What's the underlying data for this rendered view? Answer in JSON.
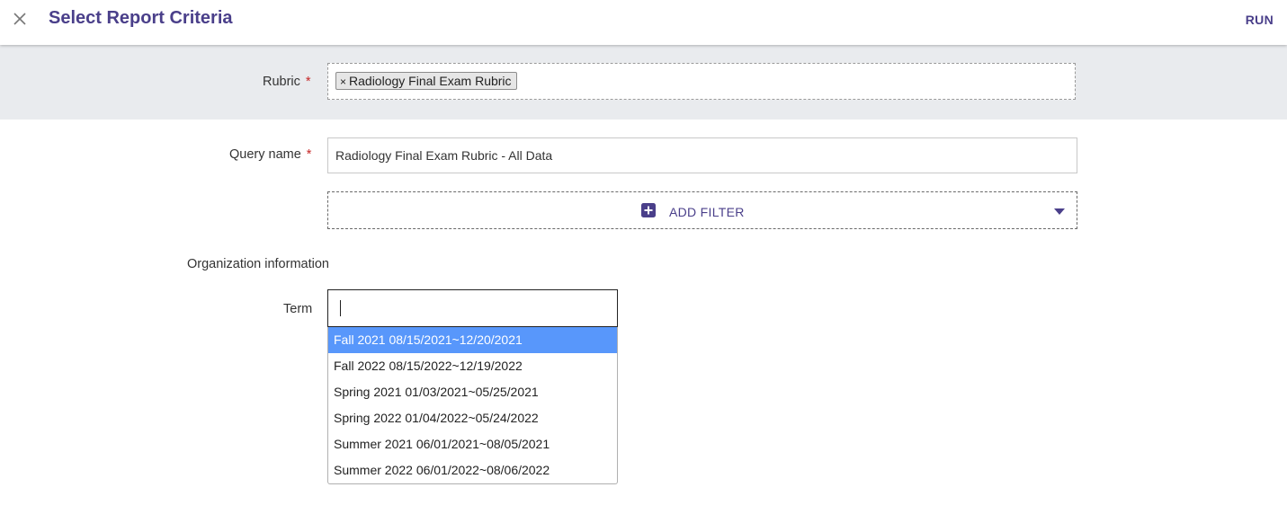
{
  "header": {
    "title": "Select Report Criteria",
    "run_label": "RUN",
    "close_icon": "close-icon"
  },
  "rubric": {
    "label": "Rubric",
    "required_mark": "*",
    "chip_remove": "×",
    "chip_label": "Radiology Final Exam Rubric"
  },
  "query": {
    "label": "Query name",
    "required_mark": "*",
    "value": "Radiology Final Exam Rubric - All Data"
  },
  "add_filter": {
    "label": "ADD FILTER",
    "icon": "plus-square-icon",
    "dropdown_icon": "caret-down-icon"
  },
  "organization": {
    "section_title": "Organization information",
    "term_label": "Term",
    "term_value": "",
    "term_options": [
      "Fall 2021 08/15/2021~12/20/2021",
      "Fall 2022 08/15/2022~12/19/2022",
      "Spring 2021 01/03/2021~05/25/2021",
      "Spring 2022 01/04/2022~05/24/2022",
      "Summer 2021 06/01/2021~08/05/2021",
      "Summer 2022 06/01/2022~08/06/2022"
    ],
    "highlighted_option": "Fall 2021 08/15/2021~12/20/2021"
  },
  "colors": {
    "accent": "#4a3f8a",
    "required": "#c62828",
    "highlight": "#5897fb",
    "band": "#e9ebee"
  }
}
